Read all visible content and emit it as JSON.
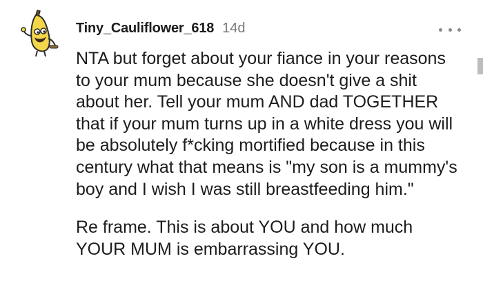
{
  "comment": {
    "username": "Tiny_Cauliflower_618",
    "age": "14d",
    "paragraphs": [
      "NTA but forget about your fiance in your reasons to your mum because she doesn't give a shit about her. Tell your mum AND dad TOGETHER that if your mum turns up in a white dress you will be absolutely f*cking mortified because in this century what that means is \"my son is a mummy's boy and I wish I was still breastfeeding him.\"",
      "Re frame. This is about YOU and how much YOUR MUM is embarrassing YOU."
    ]
  },
  "icons": {
    "avatar": "banana-avatar-icon",
    "more": "more-options-icon"
  },
  "colors": {
    "text": "#1c1c1c",
    "muted": "#787878",
    "avatar_yellow": "#f3d64a",
    "avatar_outline": "#2b2b2b"
  }
}
